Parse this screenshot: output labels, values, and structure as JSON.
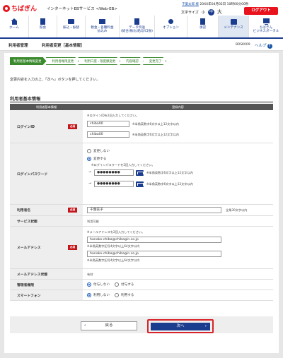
{
  "header": {
    "logo": "ちばぎん",
    "service_name": "インターネットEBサービス <Web-EB>",
    "user_name": "千葉太郎 様",
    "last_login": "20XX年04月02日 10時00分00秒",
    "font_size_label": "文字サイズ",
    "font_small": "小",
    "font_mid": "中",
    "font_large": "大",
    "logout": "ログアウト"
  },
  "nav": [
    {
      "icon": "home-icon",
      "label": "ホーム"
    },
    {
      "icon": "inquiry-icon",
      "label": "照会"
    },
    {
      "icon": "transfer-icon",
      "label": "振込・振替"
    },
    {
      "icon": "tax-payment-icon",
      "label": "税金・各種料金\n払込み"
    },
    {
      "icon": "data-transfer-icon",
      "label": "データ伝送\n(総合/振込/給与/口振)"
    },
    {
      "icon": "option-icon",
      "label": "オプション"
    },
    {
      "icon": "approval-icon",
      "label": "承認"
    },
    {
      "icon": "maintenance-icon",
      "label": "メンテナンス"
    },
    {
      "icon": "portal-icon",
      "label": "ちばぎん\nビジネスポータル"
    }
  ],
  "titlebar": {
    "section": "利用者管理",
    "page_title": "利用者変更［基本情報］",
    "screen_id": "BRSK009",
    "help": "ヘルプ",
    "help_mark": "?"
  },
  "steps": [
    "利用者基本情報変更",
    "利用者権限変更",
    "利用口座・限度額変更",
    "内容確認",
    "変更完了"
  ],
  "message": "変更内容を入力の上、「次へ」ボタンを押してください。",
  "section_title": "利用者基本情報",
  "table": {
    "col_label": "利用者基本情報",
    "col_value": "登録内容",
    "required": "必須",
    "login_id": {
      "label": "ログインID",
      "note": "※ログインIDを2回入力してください。",
      "value1": "chiba00",
      "value2": "chiba00",
      "hint": "※半角英数字6文字以上12文字以内"
    },
    "login_password": {
      "label": "ログインパスワード",
      "option_keep": "変更しない",
      "option_change": "変更する",
      "note": "※ログインパスワードを2回入力してください。",
      "value1": "●●●●●●●●",
      "value2": "●●●●●●●●",
      "hint": "※半角英数字6文字以上12文字以内"
    },
    "user_name": {
      "label": "利用者名",
      "value": "千葉花子",
      "hint": "全角30文字以内"
    },
    "service_status": {
      "label": "サービス状態",
      "value": "利用可能"
    },
    "email": {
      "label": "メールアドレス",
      "note": "※メールアドレスを2回入力してください。",
      "value1": "hanako-chiba@chibagin.co.jp",
      "hint1": "※半角英数字記号4文字以上64文字以内",
      "value2": "hanako-chiba@chibagin.co.jp",
      "hint2": "※半角英数字記号4文字以上64文字以内"
    },
    "email_status": {
      "label": "メールアドレス状態",
      "value": "有効"
    },
    "admin_rights": {
      "label": "管理者権限",
      "option_off": "付与しない",
      "option_on": "付与する"
    },
    "smartphone": {
      "label": "スマートフォン",
      "option_off": "利用しない",
      "option_on": "利用する"
    }
  },
  "buttons": {
    "back": "戻る",
    "back_arrow": "‹",
    "next": "次へ",
    "next_arrow": "›"
  }
}
